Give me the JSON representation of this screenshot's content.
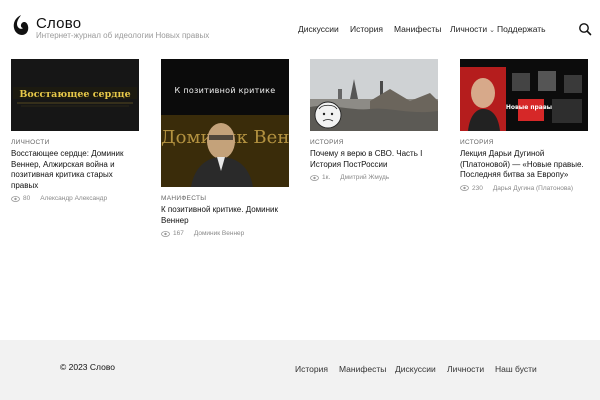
{
  "header": {
    "site_title": "Слово",
    "tagline": "Интернет-журнал об идеологии Новых правых",
    "nav": [
      "Дискуссии",
      "История",
      "Манифесты",
      "Личности",
      "Поддержать"
    ]
  },
  "posts": [
    {
      "thumb_text": "Восстающее сердце",
      "category": "Личности",
      "title": "Восстающее сердце: Доминик Веннер, Алжирская война и позитивная критика старых правых",
      "views": "80",
      "author": "Александр Александр"
    },
    {
      "thumb_text": "К позитивной критике",
      "thumb_text_2": "Доминик Веннер",
      "category": "Манифесты",
      "title": "К позитивной критике. Доминик Веннер",
      "views": "167",
      "author": "Доминик Веннер"
    },
    {
      "category": "История",
      "title": "Почему я верю в СВО. Часть I История ПостРоссии",
      "views": "1к.",
      "author": "Дмитрий Жмудь"
    },
    {
      "thumb_text": "Новые правые",
      "category": "История",
      "title": "Лекция Дарьи Дугиной (Платоновой) — «Новые правые. Последняя битва за Европу»",
      "views": "230",
      "author": "Дарья Дугина (Платонова)"
    }
  ],
  "footer": {
    "copyright": "© 2023 Слово",
    "nav": [
      "История",
      "Манифесты",
      "Дискуссии",
      "Личности",
      "Наш бусти"
    ]
  },
  "colors": {
    "background": "#ffffff",
    "footer_bg": "#f2f2f2",
    "thumb_yellow": "#e8c94a",
    "thumb_red": "#d62828"
  },
  "icons": [
    "logo-icon",
    "search-icon",
    "chevron-down-icon",
    "eye-icon"
  ]
}
